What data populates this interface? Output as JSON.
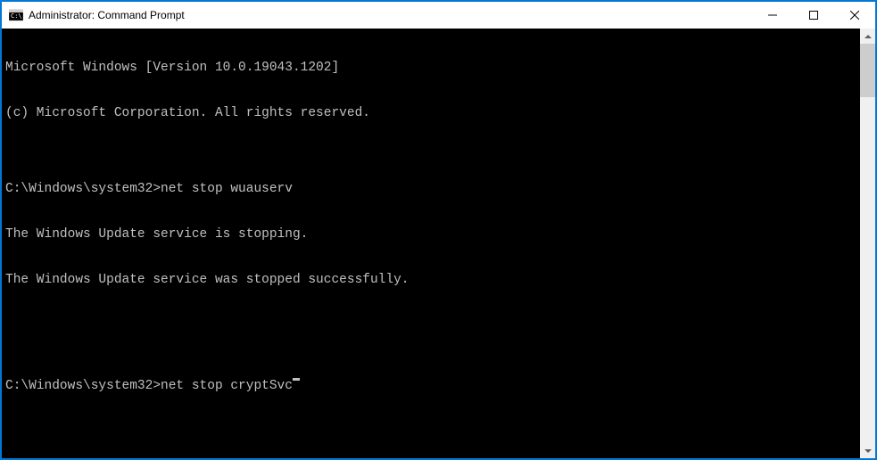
{
  "window": {
    "title": "Administrator: Command Prompt"
  },
  "terminal": {
    "line0": "Microsoft Windows [Version 10.0.19043.1202]",
    "line1": "(c) Microsoft Corporation. All rights reserved.",
    "line2": "",
    "prompt1_path": "C:\\Windows\\system32>",
    "prompt1_cmd": "net stop wuauserv",
    "line3": "The Windows Update service is stopping.",
    "line4": "The Windows Update service was stopped successfully.",
    "line5": "",
    "line6": "",
    "prompt2_path": "C:\\Windows\\system32>",
    "prompt2_cmd": "net stop cryptSvc"
  }
}
